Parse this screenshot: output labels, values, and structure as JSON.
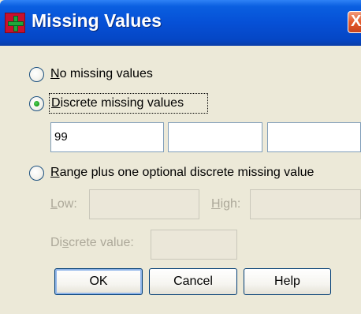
{
  "window": {
    "title": "Missing Values",
    "close_glyph": "X"
  },
  "options": {
    "no_missing": {
      "mnemonic": "N",
      "rest": "o missing values",
      "selected": false
    },
    "discrete": {
      "mnemonic": "D",
      "rest": "iscrete missing values",
      "selected": true
    },
    "range": {
      "mnemonic": "R",
      "rest": "ange plus one optional discrete missing value",
      "selected": false
    }
  },
  "discrete_values": [
    "99",
    "",
    ""
  ],
  "range": {
    "low_mnemonic": "L",
    "low_rest": "ow:",
    "high_mnemonic": "H",
    "high_rest": "igh:",
    "discrete_pre": "Di",
    "discrete_mnemonic": "s",
    "discrete_rest": "crete value:",
    "low_value": "",
    "high_value": "",
    "discrete_value": ""
  },
  "buttons": {
    "ok": "OK",
    "cancel": "Cancel",
    "help": "Help"
  },
  "colors": {
    "titlebar": "#0650d6",
    "dialog_bg": "#ece9d8",
    "radio_selected": "#21a121",
    "close_button": "#e35a2c"
  },
  "icons": [
    "app-icon",
    "close-icon"
  ]
}
